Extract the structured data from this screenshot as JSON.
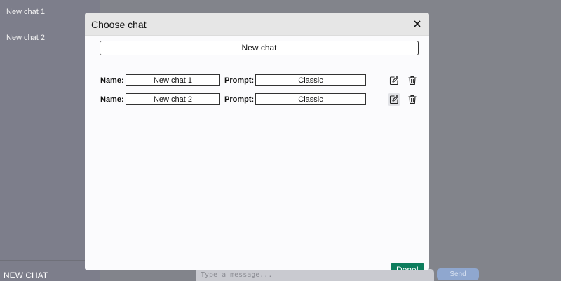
{
  "sidebar": {
    "items": [
      {
        "label": "New chat 1"
      },
      {
        "label": "New chat 2"
      }
    ],
    "new_chat_label": "NEW CHAT"
  },
  "composer": {
    "placeholder": "Type a message...",
    "send_label": "Send"
  },
  "modal": {
    "title": "Choose chat",
    "close_icon": "close-icon",
    "new_chat_label": "New chat",
    "rows": [
      {
        "name_label": "Name:",
        "name_value": "New chat 1",
        "prompt_label": "Prompt:",
        "prompt_value": "Classic",
        "edit_icon": "edit-icon",
        "delete_icon": "trash-icon"
      },
      {
        "name_label": "Name:",
        "name_value": "New chat 2",
        "prompt_label": "Prompt:",
        "prompt_value": "Classic",
        "edit_icon": "edit-icon",
        "delete_icon": "trash-icon"
      }
    ],
    "done_label": "Done!"
  },
  "colors": {
    "done_button": "#0d7d5d",
    "send_button": "#8fa7cf",
    "overlay": "#83858e"
  }
}
